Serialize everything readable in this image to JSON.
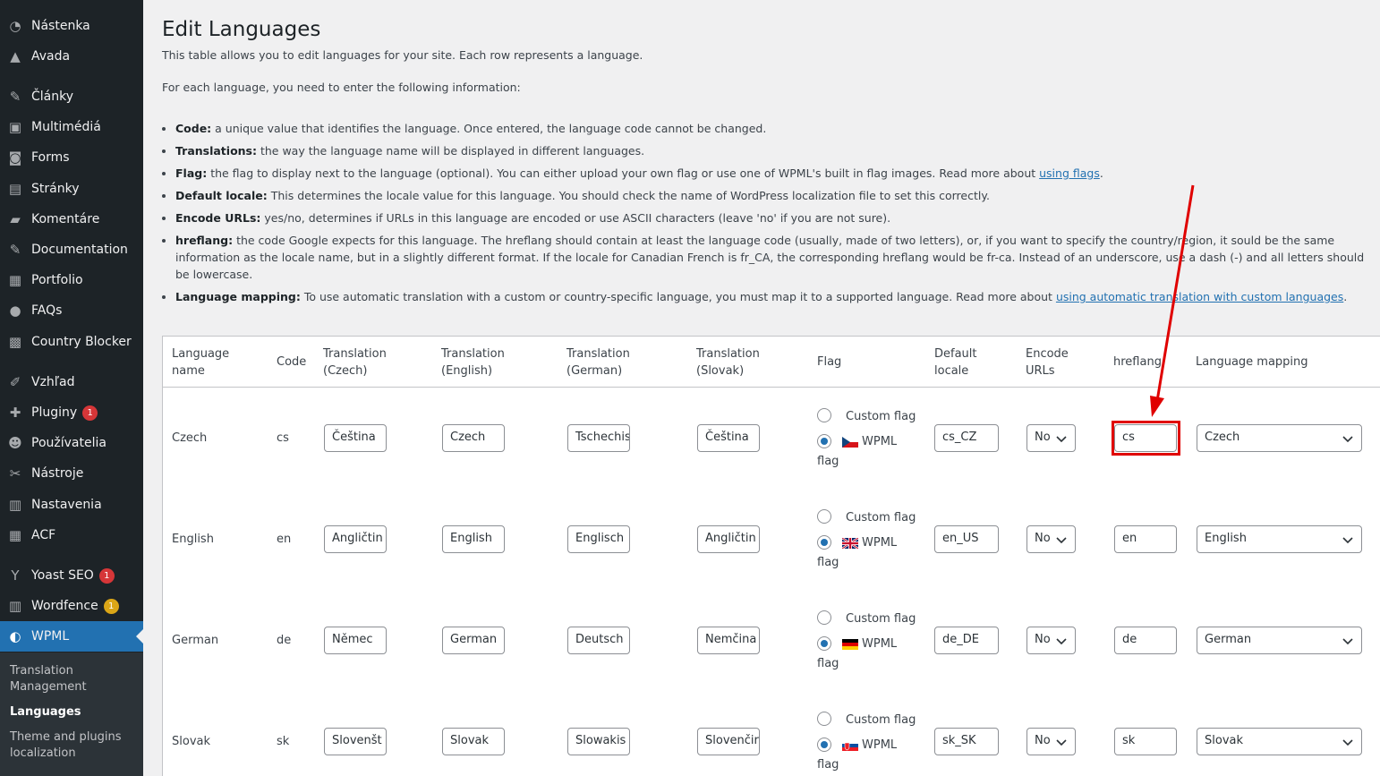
{
  "sidebar": {
    "items": [
      {
        "label": "Nástenka",
        "icon": "dashboard-icon",
        "glyph": "◔"
      },
      {
        "label": "Avada",
        "icon": "avada-icon",
        "glyph": "▲"
      },
      {
        "label": "Články",
        "icon": "pin-icon",
        "glyph": "✎"
      },
      {
        "label": "Multimédiá",
        "icon": "media-icon",
        "glyph": "▣"
      },
      {
        "label": "Forms",
        "icon": "forms-icon",
        "glyph": "◙"
      },
      {
        "label": "Stránky",
        "icon": "pages-icon",
        "glyph": "▤"
      },
      {
        "label": "Komentáre",
        "icon": "comments-icon",
        "glyph": "▰"
      },
      {
        "label": "Documentation",
        "icon": "pin-icon",
        "glyph": "✎"
      },
      {
        "label": "Portfolio",
        "icon": "portfolio-icon",
        "glyph": "▦"
      },
      {
        "label": "FAQs",
        "icon": "info-icon",
        "glyph": "●"
      },
      {
        "label": "Country Blocker",
        "icon": "ip-icon",
        "glyph": "▩"
      },
      {
        "label": "Vzhľad",
        "icon": "brush-icon",
        "glyph": "✐"
      },
      {
        "label": "Pluginy",
        "icon": "plugin-icon",
        "glyph": "✚",
        "badge": "1"
      },
      {
        "label": "Používatelia",
        "icon": "user-icon",
        "glyph": "☻"
      },
      {
        "label": "Nástroje",
        "icon": "wrench-icon",
        "glyph": "✂"
      },
      {
        "label": "Nastavenia",
        "icon": "settings-icon",
        "glyph": "▥"
      },
      {
        "label": "ACF",
        "icon": "acf-icon",
        "glyph": "▦"
      },
      {
        "label": "Yoast SEO",
        "icon": "yoast-icon",
        "glyph": "Y",
        "badge": "1"
      },
      {
        "label": "Wordfence",
        "icon": "wordfence-icon",
        "glyph": "▥",
        "badge": "1"
      },
      {
        "label": "WPML",
        "icon": "wpml-icon",
        "glyph": "◐"
      }
    ],
    "submenu": [
      "Translation Management",
      "Languages",
      "Theme and plugins localization"
    ]
  },
  "page": {
    "title": "Edit Languages",
    "intro": "This table allows you to edit languages for your site. Each row represents a language.",
    "for_each": "For each language, you need to enter the following information:",
    "bullets": [
      {
        "term": "Code:",
        "text": " a unique value that identifies the language. Once entered, the language code cannot be changed."
      },
      {
        "term": "Translations:",
        "text": " the way the language name will be displayed in different languages."
      },
      {
        "term": "Flag:",
        "text": " the flag to display next to the language (optional). You can either upload your own flag or use one of WPML's built in flag images. Read more about ",
        "link": "using flags",
        "after": "."
      },
      {
        "term": "Default locale:",
        "text": " This determines the locale value for this language. You should check the name of WordPress localization file to set this correctly."
      },
      {
        "term": "Encode URLs:",
        "text": " yes/no, determines if URLs in this language are encoded or use ASCII characters (leave 'no' if you are not sure)."
      },
      {
        "term": "hreflang:",
        "text": " the code Google expects for this language. The hreflang should contain at least the language code (usually, made of two letters), or, if you want to specify the country/region, it sould be the same information as the locale name, but in a slightly different format. If the locale for Canadian French is fr_CA, the corresponding hreflang would be fr-ca. Instead of an underscore, use a dash (-) and all letters should be lowercase."
      },
      {
        "term": "Language mapping:",
        "text": " To use automatic translation with a custom or country-specific language, you must map it to a supported language. Read more about ",
        "link": "using automatic translation with custom languages",
        "after": "."
      }
    ]
  },
  "table": {
    "headers": {
      "name": [
        "Language",
        "name"
      ],
      "code": [
        "Code"
      ],
      "tr_cz": [
        "Translation",
        "(Czech)"
      ],
      "tr_en": [
        "Translation",
        "(English)"
      ],
      "tr_de": [
        "Translation",
        "(German)"
      ],
      "tr_sk": [
        "Translation",
        "(Slovak)"
      ],
      "flag": [
        "Flag"
      ],
      "locale": [
        "Default",
        "locale"
      ],
      "encode": [
        "Encode",
        "URLs"
      ],
      "hreflang": [
        "hreflang"
      ],
      "mapping": [
        "Language mapping"
      ]
    },
    "custom_flag_label": "Custom flag",
    "wpml_label": "WPML",
    "flag_word": "flag",
    "rows": [
      {
        "name": "Czech",
        "code": "cs",
        "tr_cz": "Čeština",
        "tr_en": "Czech",
        "tr_de": "Tschechis",
        "tr_sk": "Čeština",
        "flag": "cz",
        "locale": "cs_CZ",
        "encode": "No",
        "hreflang": "cs",
        "mapping": "Czech"
      },
      {
        "name": "English",
        "code": "en",
        "tr_cz": "Angličtin",
        "tr_en": "English",
        "tr_de": "Englisch",
        "tr_sk": "Angličtin",
        "flag": "gb",
        "locale": "en_US",
        "encode": "No",
        "hreflang": "en",
        "mapping": "English"
      },
      {
        "name": "German",
        "code": "de",
        "tr_cz": "Němec",
        "tr_en": "German",
        "tr_de": "Deutsch",
        "tr_sk": "Nemčina",
        "flag": "de",
        "locale": "de_DE",
        "encode": "No",
        "hreflang": "de",
        "mapping": "German"
      },
      {
        "name": "Slovak",
        "code": "sk",
        "tr_cz": "Slovenšt",
        "tr_en": "Slovak",
        "tr_de": "Slowakis",
        "tr_sk": "Slovenčir",
        "flag": "sk",
        "locale": "sk_SK",
        "encode": "No",
        "hreflang": "sk",
        "mapping": "Slovak"
      }
    ]
  },
  "colors": {
    "sidebar": "#1d2327",
    "active": "#2271b1",
    "highlight": "#e00000",
    "arrow": "#e00000"
  }
}
